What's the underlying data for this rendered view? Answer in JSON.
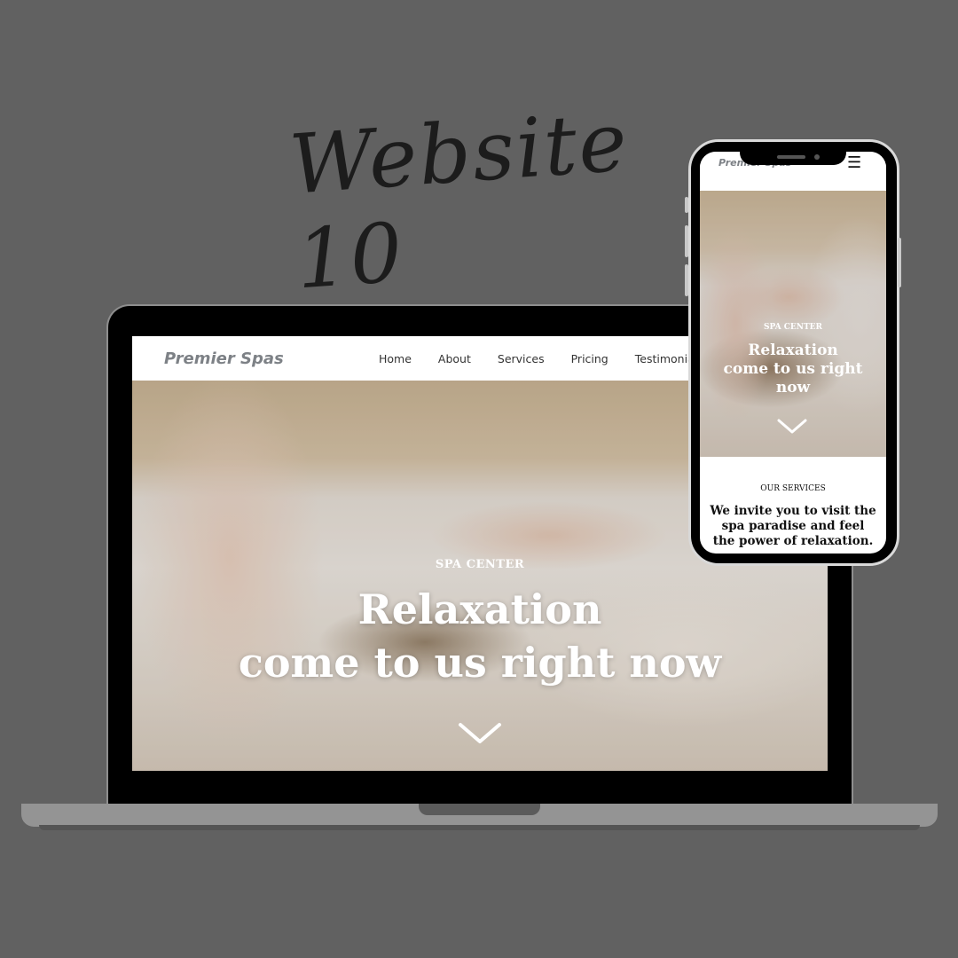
{
  "headline": "Website 10",
  "desktop": {
    "brand": "Premier Spas",
    "nav": [
      "Home",
      "About",
      "Services",
      "Pricing",
      "Testimonials"
    ],
    "hero": {
      "eyebrow": "SPA CENTER",
      "title_line1": "Relaxation",
      "title_line2": "come to us right now",
      "scroll_icon": "chevron-down-icon"
    }
  },
  "mobile": {
    "brand": "Premier Spas",
    "menu_icon": "hamburger-icon",
    "menu_glyph": "☰",
    "hero": {
      "eyebrow": "SPA CENTER",
      "title_line1": "Relaxation",
      "title_line2": "come to us right",
      "title_line3": "now",
      "scroll_icon": "chevron-down-icon"
    },
    "services": {
      "label": "OUR SERVICES",
      "line1": "We invite you to visit the",
      "line2": "spa paradise and feel",
      "line3": "the power of relaxation."
    }
  },
  "colors": {
    "background": "#616161",
    "brand_text": "#7d8186",
    "hero_text": "#ffffff"
  }
}
